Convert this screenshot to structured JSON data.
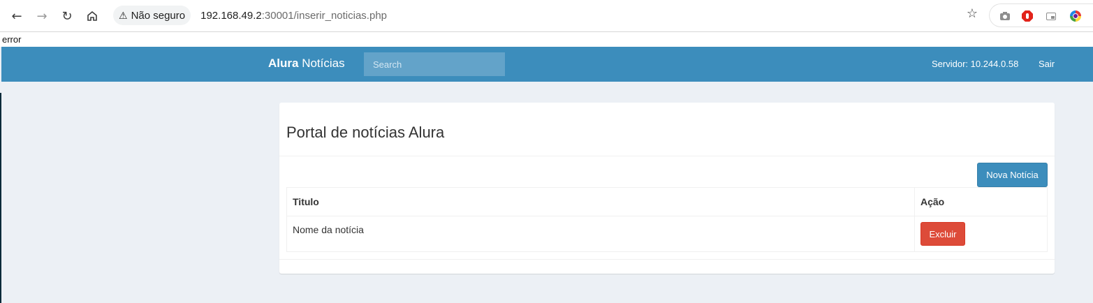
{
  "browser": {
    "security_label": "Não seguro",
    "url_host": "192.168.49.2",
    "url_rest": ":30001/inserir_noticias.php",
    "back_icon": "arrow-left-icon",
    "forward_icon": "arrow-right-icon",
    "reload_icon": "reload-icon",
    "home_icon": "home-icon",
    "bookmark_icon": "star-icon"
  },
  "page": {
    "error_text": "error",
    "navbar": {
      "brand_bold": "Alura",
      "brand_rest": " Notícias",
      "search_placeholder": "Search",
      "server_text": "Servidor: 10.244.0.58",
      "logout_label": "Sair"
    },
    "box": {
      "title": "Portal de notícias Alura",
      "new_button": "Nova Notícia",
      "table": {
        "headers": [
          "Titulo",
          "Ação"
        ],
        "rows": [
          {
            "title": "Nome da notícia",
            "action": "Excluir"
          }
        ]
      }
    }
  },
  "colors": {
    "navbar": "#3c8dbc",
    "delete_button": "#dd4b39",
    "page_background": "#ecf0f5"
  }
}
